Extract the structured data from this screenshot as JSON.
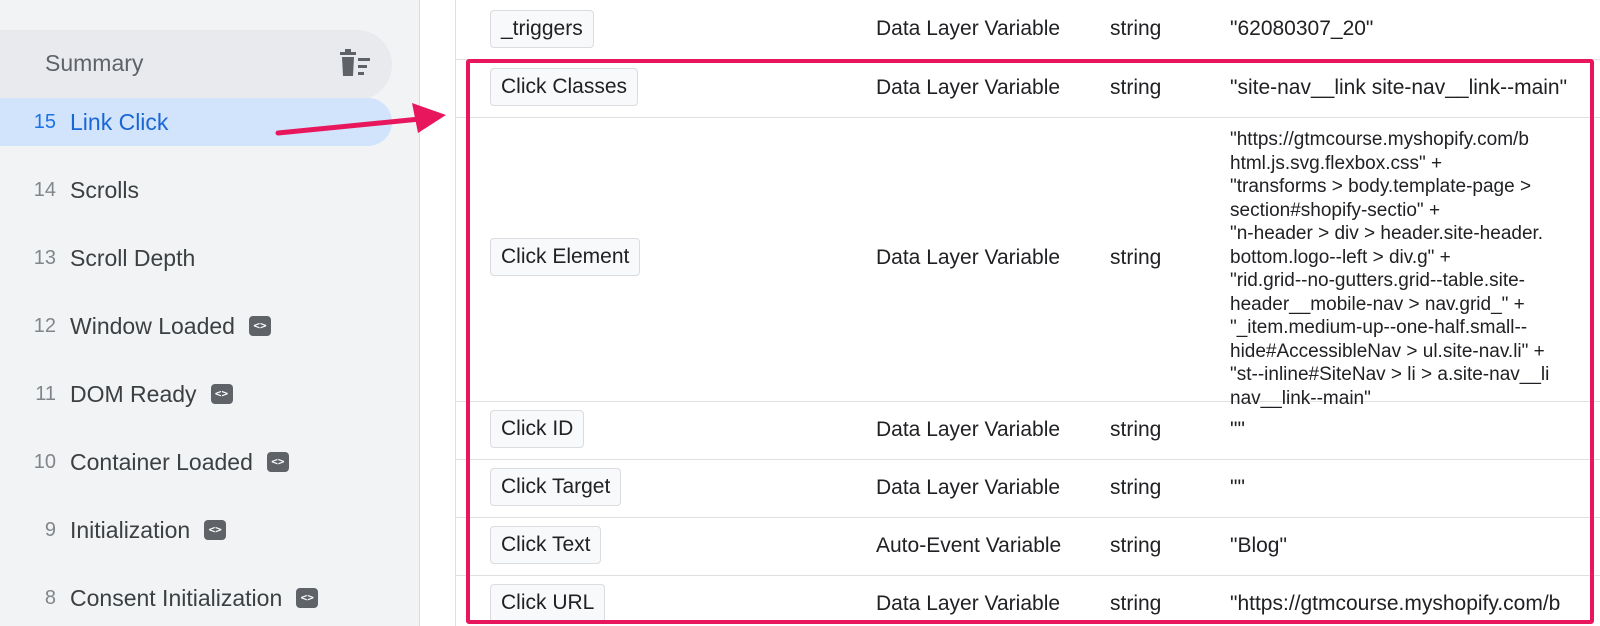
{
  "sidebar": {
    "summary_label": "Summary",
    "events": [
      {
        "num": "15",
        "name": "Link Click",
        "active": true,
        "badge": false
      },
      {
        "num": "14",
        "name": "Scrolls",
        "active": false,
        "badge": false
      },
      {
        "num": "13",
        "name": "Scroll Depth",
        "active": false,
        "badge": false
      },
      {
        "num": "12",
        "name": "Window Loaded",
        "active": false,
        "badge": true
      },
      {
        "num": "11",
        "name": "DOM Ready",
        "active": false,
        "badge": true
      },
      {
        "num": "10",
        "name": "Container Loaded",
        "active": false,
        "badge": true
      },
      {
        "num": "9",
        "name": "Initialization",
        "active": false,
        "badge": true
      },
      {
        "num": "8",
        "name": "Consent Initialization",
        "active": false,
        "badge": true
      }
    ],
    "badge_glyph": "<>"
  },
  "table": {
    "rows": [
      {
        "name": "_triggers",
        "type": "Data Layer Variable",
        "kind": "string",
        "value": "\"62080307_20\""
      },
      {
        "name": "Click Classes",
        "type": "Data Layer Variable",
        "kind": "string",
        "value": "\"site-nav__link site-nav__link--main\""
      },
      {
        "name": "Click Element",
        "type": "Data Layer Variable",
        "kind": "string",
        "value_lines": [
          "\"https://gtmcourse.myshopify.com/b",
          "html.js.svg.flexbox.css\" +",
          "\"transforms > body.template-page > ",
          "section#shopify-sectio\" +",
          "\"n-header > div > header.site-header.",
          "bottom.logo--left > div.g\" +",
          "\"rid.grid--no-gutters.grid--table.site-",
          "header__mobile-nav > nav.grid_\" +",
          "\"_item.medium-up--one-half.small--",
          "hide#AccessibleNav > ul.site-nav.li\" +",
          "\"st--inline#SiteNav > li > a.site-nav__li",
          "nav__link--main\""
        ]
      },
      {
        "name": "Click ID",
        "type": "Data Layer Variable",
        "kind": "string",
        "value": "\"\""
      },
      {
        "name": "Click Target",
        "type": "Data Layer Variable",
        "kind": "string",
        "value": "\"\""
      },
      {
        "name": "Click Text",
        "type": "Auto-Event Variable",
        "kind": "string",
        "value": "\"Blog\""
      },
      {
        "name": "Click URL",
        "type": "Data Layer Variable",
        "kind": "string",
        "value": "\"https://gtmcourse.myshopify.com/b"
      }
    ]
  },
  "colors": {
    "highlight": "#e8175d",
    "active_bg": "#d2e3fc",
    "active_text": "#1967d2"
  },
  "icons": {
    "clear": "clear-all-icon",
    "event_badge": "code-badge-icon",
    "annotation": "pink-arrow-icon"
  }
}
